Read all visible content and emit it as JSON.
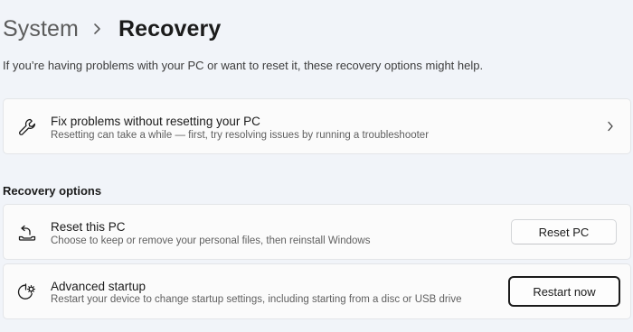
{
  "header": {
    "parent": "System",
    "separator_icon": "chevron-right-icon",
    "current": "Recovery",
    "intro": "If you’re having problems with your PC or want to reset it, these recovery options might help."
  },
  "fix_card": {
    "icon": "wrench-icon",
    "title": "Fix problems without resetting your PC",
    "description": "Resetting can take a while — first, try resolving issues by running a troubleshooter",
    "action_icon": "chevron-right-icon"
  },
  "recovery_options": {
    "label": "Recovery options",
    "items": [
      {
        "icon": "reset-pc-icon",
        "title": "Reset this PC",
        "description": "Choose to keep or remove your personal files, then reinstall Windows",
        "button_label": "Reset PC"
      },
      {
        "icon": "advanced-startup-icon",
        "title": "Advanced startup",
        "description": "Restart your device to change startup settings, including starting from a disc or USB drive",
        "button_label": "Restart now"
      }
    ]
  },
  "colors": {
    "background": "#f1f4f9",
    "card": "#fbfbfb",
    "text_primary": "#1b1b1b",
    "text_secondary": "#606060"
  }
}
